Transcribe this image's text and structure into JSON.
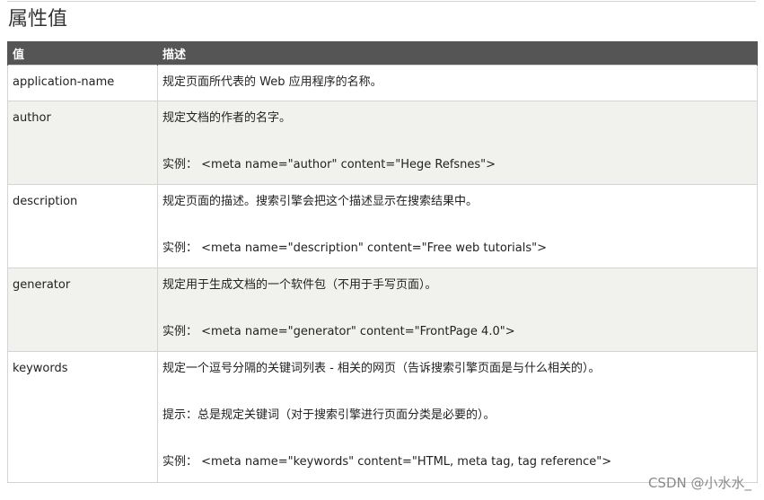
{
  "page": {
    "title": "属性值"
  },
  "table": {
    "headers": [
      "值",
      "描述"
    ],
    "rows": [
      {
        "value": "application-name",
        "desc": "规定页面所代表的 Web 应用程序的名称。",
        "example": ""
      },
      {
        "value": "author",
        "desc": "规定文档的作者的名字。",
        "example": "实例： <meta name=\"author\" content=\"Hege Refsnes\">"
      },
      {
        "value": "description",
        "desc": "规定页面的描述。搜索引擎会把这个描述显示在搜索结果中。",
        "example": "实例： <meta name=\"description\" content=\"Free web tutorials\">"
      },
      {
        "value": "generator",
        "desc": "规定用于生成文档的一个软件包（不用于手写页面）。",
        "example": "实例： <meta name=\"generator\" content=\"FrontPage 4.0\">"
      },
      {
        "value": "keywords",
        "desc": "规定一个逗号分隔的关键词列表 - 相关的网页（告诉搜索引擎页面是与什么相关的）。",
        "tip": "提示：总是规定关键词（对于搜索引擎进行页面分类是必要的）。",
        "example": "实例： <meta name=\"keywords\" content=\"HTML, meta tag, tag reference\">"
      }
    ]
  },
  "watermark": "CSDN @小水水_"
}
